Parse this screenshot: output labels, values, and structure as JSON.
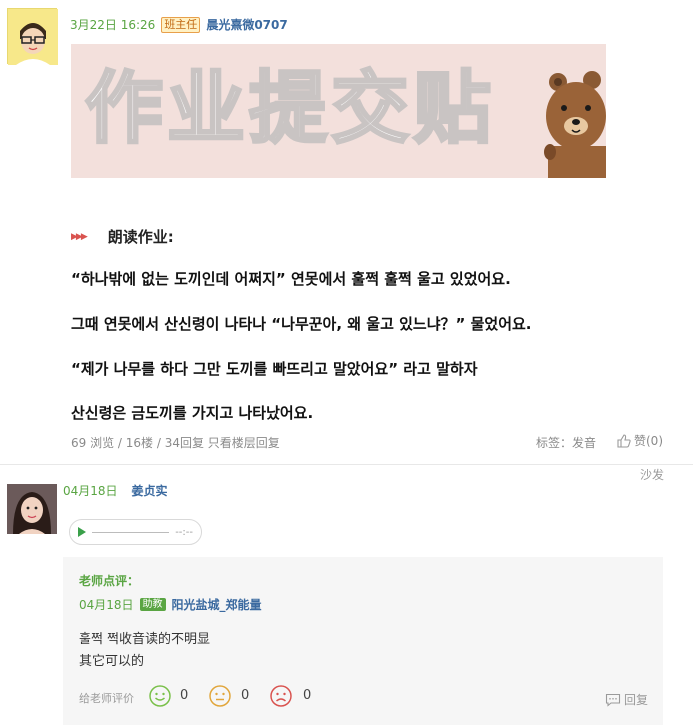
{
  "post": {
    "date": "3月22日 16:26",
    "badge": "班主任",
    "username": "晨光熹微0707",
    "banner_text": "作业提交贴",
    "section_title": "朗读作业:",
    "lines": [
      "“하나밖에 없는 도끼인데 어쩌지”  연못에서 훌쩍 훌쩍 울고 있었어요.",
      "그때 연못에서 산신령이 나타나 “나무꾼아, 왜 울고 있느냐？”  물었어요.",
      "“제가 나무를 하다 그만 도끼를 빠뜨리고 말았어요” 라고 말하자",
      "산신령은 금도끼를 가지고 나타났어요."
    ],
    "stats": "69 浏览 / 16楼 / 34回复 只看楼层回复",
    "tags": "标签：发音",
    "like": "赞(0)",
    "sofa": "沙发"
  },
  "reply": {
    "date": "04月18日",
    "username": "姜贞实",
    "audio_time": "--:--",
    "teacher_comment": {
      "label": "老师点评：",
      "date": "04月18日",
      "badge": "助教",
      "username": "阳光盐城_郑能量",
      "line1": "훌쩍 쩍收音读的不明显",
      "line2": "其它可以的",
      "rate_label": "给老师评价",
      "counts": [
        "0",
        "0",
        "0"
      ],
      "reply_label": "回复"
    }
  },
  "colors": {
    "accent_green": "#5aa543",
    "link_blue": "#3b6aa0",
    "banner_bg": "#f3e0dc"
  }
}
